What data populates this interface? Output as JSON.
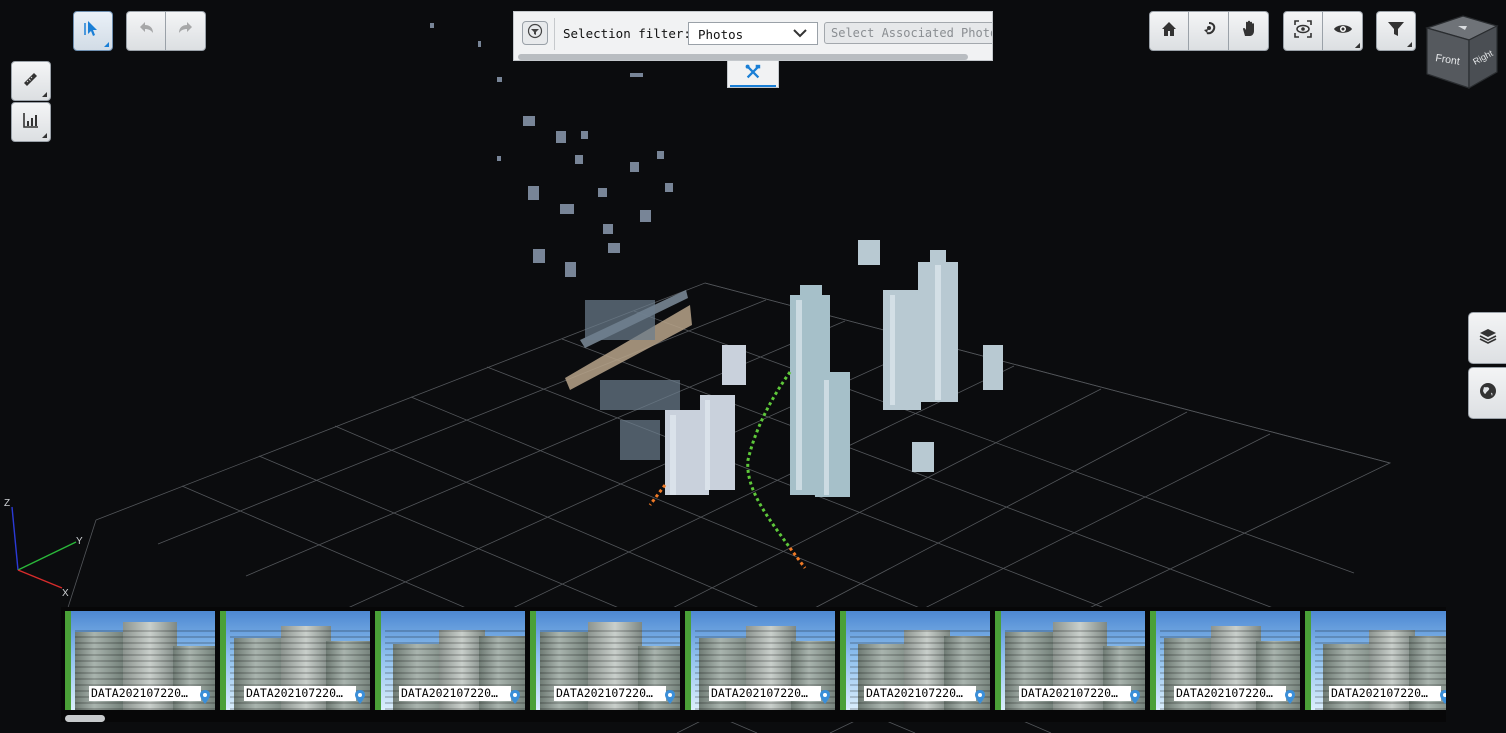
{
  "selection_panel": {
    "filter_label": "Selection filter:",
    "filter_value": "Photos",
    "associated_placeholder": "Select Associated Photos"
  },
  "toolbar": {
    "select_tool": "select-arrow-icon",
    "undo": "undo-icon",
    "redo": "redo-icon",
    "measure": "ruler-icon",
    "chart": "chart-icon",
    "home": "home-icon",
    "orbit": "orbit-icon",
    "pan": "pan-hand-icon",
    "focus": "focus-eye-icon",
    "visibility": "eye-icon",
    "filter": "filter-icon",
    "tools_tab": "tools-icon"
  },
  "viewcube": {
    "front": "Front",
    "right": "Right"
  },
  "side_tabs": [
    "layers-icon",
    "globe-icon"
  ],
  "axes": {
    "x": "X",
    "y": "Y",
    "z": "Z"
  },
  "colors": {
    "accent": "#1a7fd6",
    "photo_bar": "#4aa037",
    "camera_path": "#5ec83a",
    "camera_path_end": "#f07a26"
  },
  "filmstrip": {
    "photos": [
      {
        "caption": "DATA202107220…"
      },
      {
        "caption": "DATA202107220…"
      },
      {
        "caption": "DATA202107220…"
      },
      {
        "caption": "DATA202107220…"
      },
      {
        "caption": "DATA202107220…"
      },
      {
        "caption": "DATA202107220…"
      },
      {
        "caption": "DATA202107220…"
      },
      {
        "caption": "DATA202107220…"
      },
      {
        "caption": "DATA202107220…"
      }
    ]
  }
}
